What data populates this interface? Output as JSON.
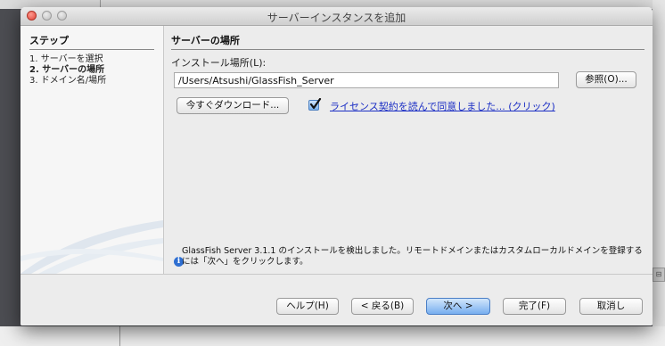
{
  "window": {
    "title": "サーバーインスタンスを追加"
  },
  "steps": {
    "header": "ステップ",
    "items": [
      {
        "label": "1.   サーバーを選択"
      },
      {
        "label": "2.   サーバーの場所"
      },
      {
        "label": "3.   ドメイン名/場所"
      }
    ],
    "current_index": 1
  },
  "main": {
    "section_title": "サーバーの場所",
    "location_label": "インストール場所(L):",
    "location_value": "/Users/Atsushi/GlassFish_Server",
    "browse_label": "参照(O)...",
    "download_label": "今すぐダウンロード...",
    "license_checked": true,
    "license_label": "ライセンス契約を読んで同意しました... (クリック)",
    "info_text": "GlassFish Server 3.1.1 のインストールを検出しました。リモートドメインまたはカスタムローカルドメインを登録するには「次へ」をクリックします。"
  },
  "footer": {
    "help_label": "ヘルプ(H)",
    "back_label": "< 戻る(B)",
    "next_label": "次へ >",
    "finish_label": "完了(F)",
    "cancel_label": "取消し"
  },
  "colors": {
    "link": "#1a2dc4",
    "default_button": "#77aeef",
    "close_light": "#e0443a"
  }
}
